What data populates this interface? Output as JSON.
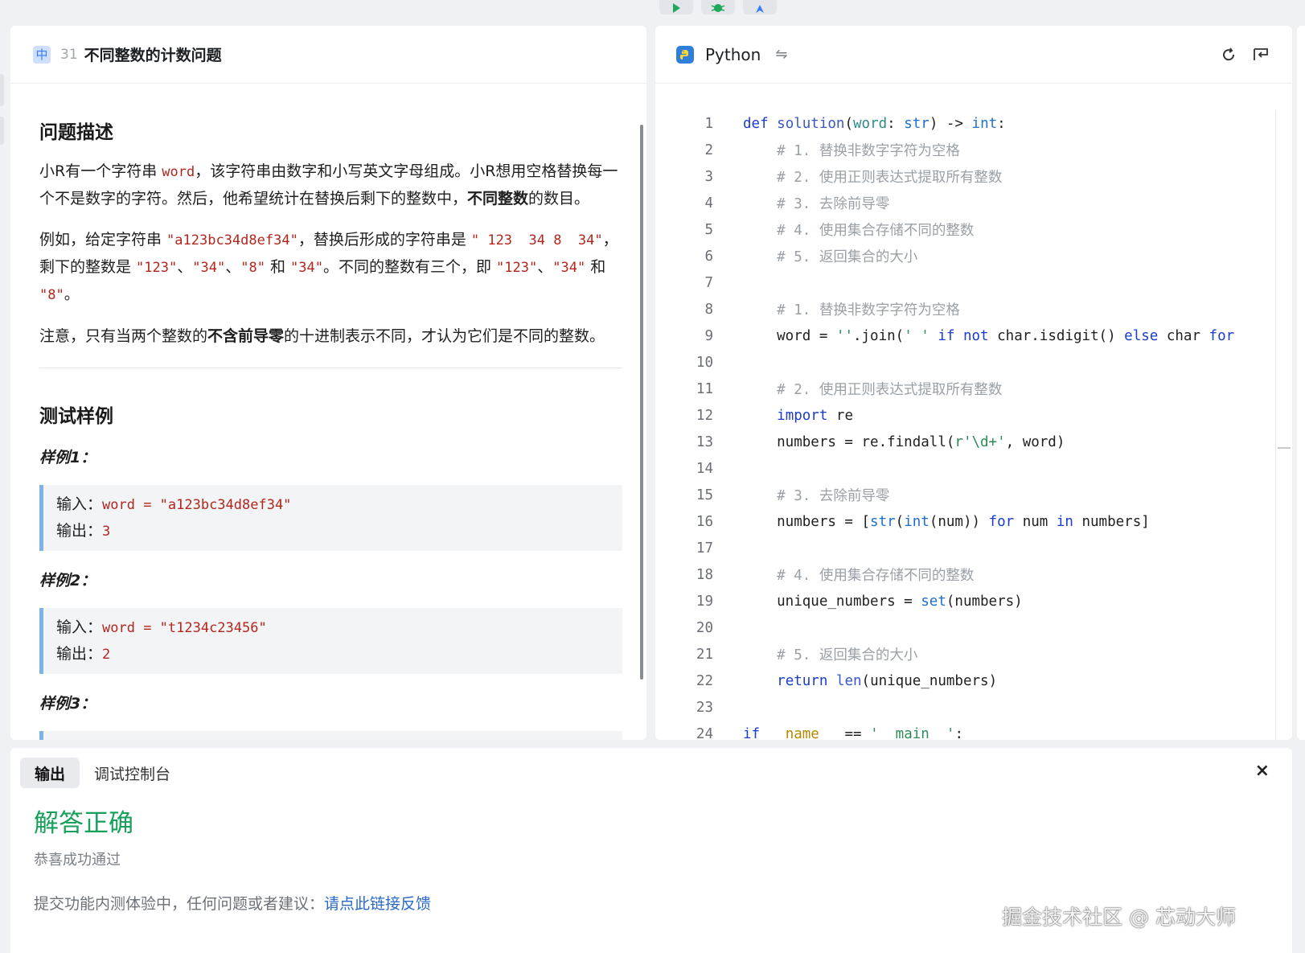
{
  "toolbar": {
    "run_icon": "play-icon",
    "debug_icon": "bug-icon",
    "submit_icon": "rocket-icon"
  },
  "question": {
    "difficulty": "中",
    "number": "31",
    "title": "不同整数的计数问题"
  },
  "description": {
    "heading": "问题描述",
    "p1_a": "小R有一个字符串 ",
    "p1_code": "word",
    "p1_b": "，该字符串由数字和小写英文字母组成。小R想用空格替换每一个不是数字的字符。然后，他希望统计在替换后剩下的整数中，",
    "p1_bold": "不同整数",
    "p1_c": "的数目。",
    "p2_a": "例如，给定字符串 ",
    "p2_code1": "\"a123bc34d8ef34\"",
    "p2_b": "，替换后形成的字符串是 ",
    "p2_code2": "\" 123  34 8  34\"",
    "p2_c": "，剩下的整数是 ",
    "p2_code3": "\"123\"",
    "p2_d": "、",
    "p2_code4": "\"34\"",
    "p2_e": "、",
    "p2_code5": "\"8\"",
    "p2_f": " 和 ",
    "p2_code6": "\"34\"",
    "p2_g": "。不同的整数有三个，即 ",
    "p2_code7": "\"123\"",
    "p2_h": "、",
    "p2_code8": "\"34\"",
    "p2_i": " 和 ",
    "p2_code9": "\"8\"",
    "p2_j": "。",
    "p3_a": "注意，只有当两个整数的",
    "p3_bold": "不含前导零",
    "p3_b": "的十进制表示不同，才认为它们是不同的整数。"
  },
  "samples": {
    "heading": "测试样例",
    "items": [
      {
        "label": "样例1：",
        "input_label": "输入：",
        "input": "word = \"a123bc34d8ef34\"",
        "output_label": "输出：",
        "output": "3"
      },
      {
        "label": "样例2：",
        "input_label": "输入：",
        "input": "word = \"t1234c23456\"",
        "output_label": "输出：",
        "output": "2"
      },
      {
        "label": "样例3："
      }
    ]
  },
  "editor": {
    "language": "Python",
    "swap_icon": "swap-icon",
    "reset_icon": "refresh-icon",
    "wrap_icon": "wrap-icon",
    "line_numbers": [
      "1",
      "2",
      "3",
      "4",
      "5",
      "6",
      "7",
      "8",
      "9",
      "10",
      "11",
      "12",
      "13",
      "14",
      "15",
      "16",
      "17",
      "18",
      "19",
      "20",
      "21",
      "22",
      "23",
      "24"
    ]
  },
  "output_panel": {
    "tab_output": "输出",
    "tab_console": "调试控制台",
    "close": "×",
    "result": "解答正确",
    "result_sub": "恭喜成功通过",
    "feedback_text": "提交功能内测体验中，任何问题或者建议：",
    "feedback_link": "请点此链接反馈",
    "watermark": "掘金技术社区 @ 芯动大师"
  },
  "colors": {
    "accent": "#2a68c8",
    "success": "#16a05a",
    "keyword": "#1a3ccf",
    "string_red": "#b3261e"
  }
}
